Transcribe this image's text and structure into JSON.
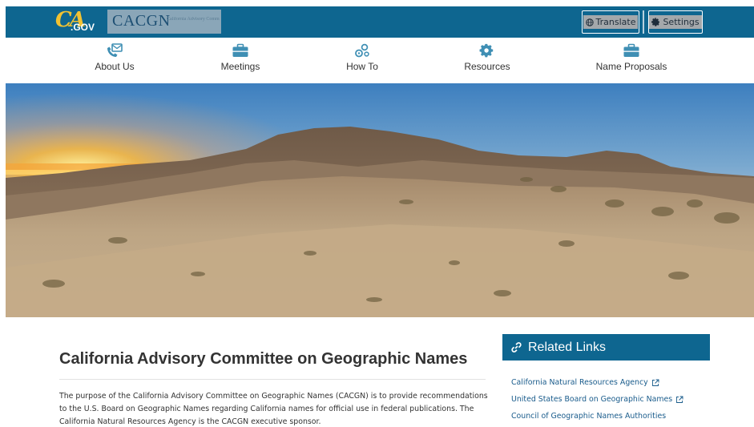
{
  "header": {
    "ca_logo": {
      "ca": "CA",
      "gov": ".GOV"
    },
    "cacgn_logo": {
      "acronym": "CACGN",
      "subtitle": "California Advisory Committee on Geographic Names"
    },
    "translate_label": "Translate",
    "settings_label": "Settings"
  },
  "nav": {
    "items": [
      {
        "label": "About Us",
        "icon": "contact-phone-icon"
      },
      {
        "label": "Meetings",
        "icon": "briefcase-icon"
      },
      {
        "label": "How To",
        "icon": "gears-icon"
      },
      {
        "label": "Resources",
        "icon": "gear-icon"
      },
      {
        "label": "Name Proposals",
        "icon": "briefcase-icon"
      }
    ]
  },
  "main": {
    "title": "California Advisory Committee on Geographic Names",
    "paragraph": "The purpose of the California Advisory Committee on Geographic Names (CACGN) is to provide recommendations to the U.S. Board on Geographic Names regarding California names for official use in federal publications. The California Natural Resources Agency is the CACGN executive sponsor."
  },
  "related": {
    "title": "Related Links",
    "links": [
      {
        "label": "California Natural Resources Agency",
        "external": true
      },
      {
        "label": "United States Board on Geographic Names",
        "external": true
      },
      {
        "label": "Council of Geographic Names Authorities",
        "external": false
      }
    ]
  },
  "colors": {
    "brand_blue": "#0e6690",
    "link_blue": "#1a5c8c",
    "icon_teal": "#3f8fb4",
    "logo_gold": "#f1c232"
  }
}
